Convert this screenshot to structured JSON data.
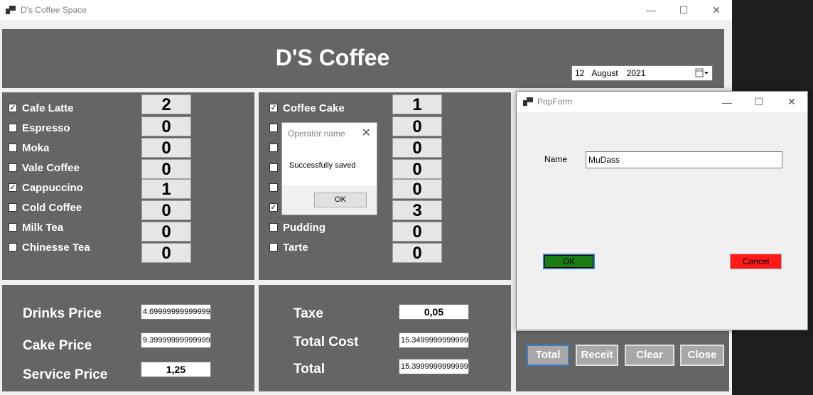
{
  "window": {
    "title": "D's Coffee Space",
    "minimize": "—",
    "maximize": "☐",
    "close": "✕"
  },
  "header": {
    "title": "D'S Coffee"
  },
  "date_picker": {
    "day": "12",
    "month": "August",
    "year": "2021",
    "icon": "calendar-dropdown-icon"
  },
  "drinks": [
    {
      "label": "Cafe Latte",
      "checked": true,
      "qty": "2"
    },
    {
      "label": "Espresso",
      "checked": false,
      "qty": "0"
    },
    {
      "label": "Moka",
      "checked": false,
      "qty": "0"
    },
    {
      "label": "Vale Coffee",
      "checked": false,
      "qty": "0"
    },
    {
      "label": "Cappuccino",
      "checked": true,
      "qty": "1"
    },
    {
      "label": "Cold Coffee",
      "checked": false,
      "qty": "0"
    },
    {
      "label": "Milk Tea",
      "checked": false,
      "qty": "0"
    },
    {
      "label": "Chinesse Tea",
      "checked": false,
      "qty": "0"
    }
  ],
  "cakes": [
    {
      "label": "Coffee Cake",
      "checked": true,
      "qty": "1"
    },
    {
      "label": "",
      "checked": false,
      "qty": "0"
    },
    {
      "label": "",
      "checked": false,
      "qty": "0"
    },
    {
      "label": "",
      "checked": false,
      "qty": "0"
    },
    {
      "label": "",
      "checked": false,
      "qty": "0"
    },
    {
      "label": "",
      "checked": true,
      "qty": "3"
    },
    {
      "label": "Pudding",
      "checked": false,
      "qty": "0"
    },
    {
      "label": "Tarte",
      "checked": false,
      "qty": "0"
    }
  ],
  "prices": {
    "drinks_label": "Drinks Price",
    "drinks_value": "4.69999999999999",
    "cake_label": "Cake Price",
    "cake_value": "9.39999999999999",
    "service_label": "Service Price",
    "service_value": "1,25"
  },
  "totals": {
    "tax_label": "Taxe",
    "tax_value": "0,05",
    "total_cost_label": "Total Cost",
    "total_cost_value": "15.3499999999999",
    "total_label": "Total",
    "total_value": "15.3999999999999"
  },
  "actions": {
    "total": "Total",
    "receipt": "Receit",
    "clear": "Clear",
    "close": "Close"
  },
  "message_box": {
    "title": "Operator name",
    "message": "Successfully saved",
    "ok": "OK"
  },
  "popform": {
    "title": "PopForm",
    "name_label": "Name",
    "name_value": "MuDass",
    "ok": "OK",
    "cancel": "Cancel"
  },
  "colors": {
    "panel": "#656565",
    "ok_green": "#1a7d14",
    "cancel_red": "#ff1a1a"
  }
}
